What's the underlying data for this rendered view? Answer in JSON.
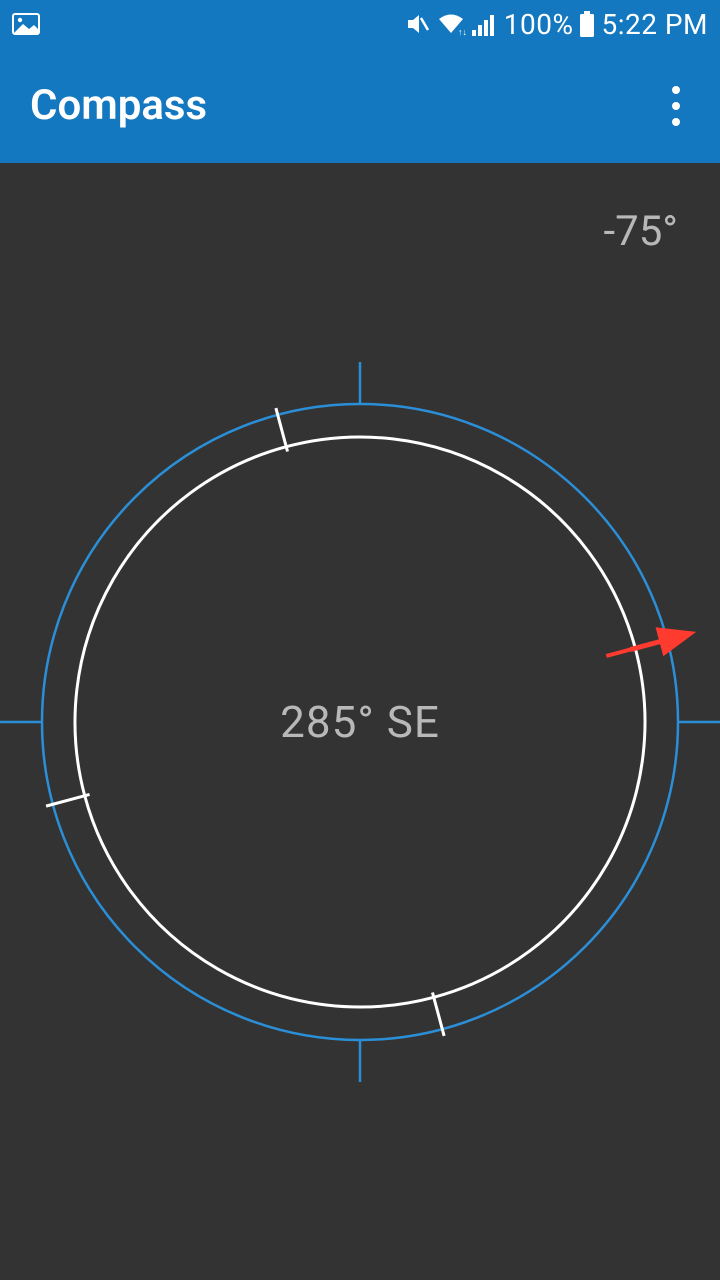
{
  "status": {
    "battery_pct": "100%",
    "time": "5:22 PM"
  },
  "app": {
    "title": "Compass"
  },
  "compass": {
    "deviation": "-75°",
    "heading": "285° SE"
  }
}
